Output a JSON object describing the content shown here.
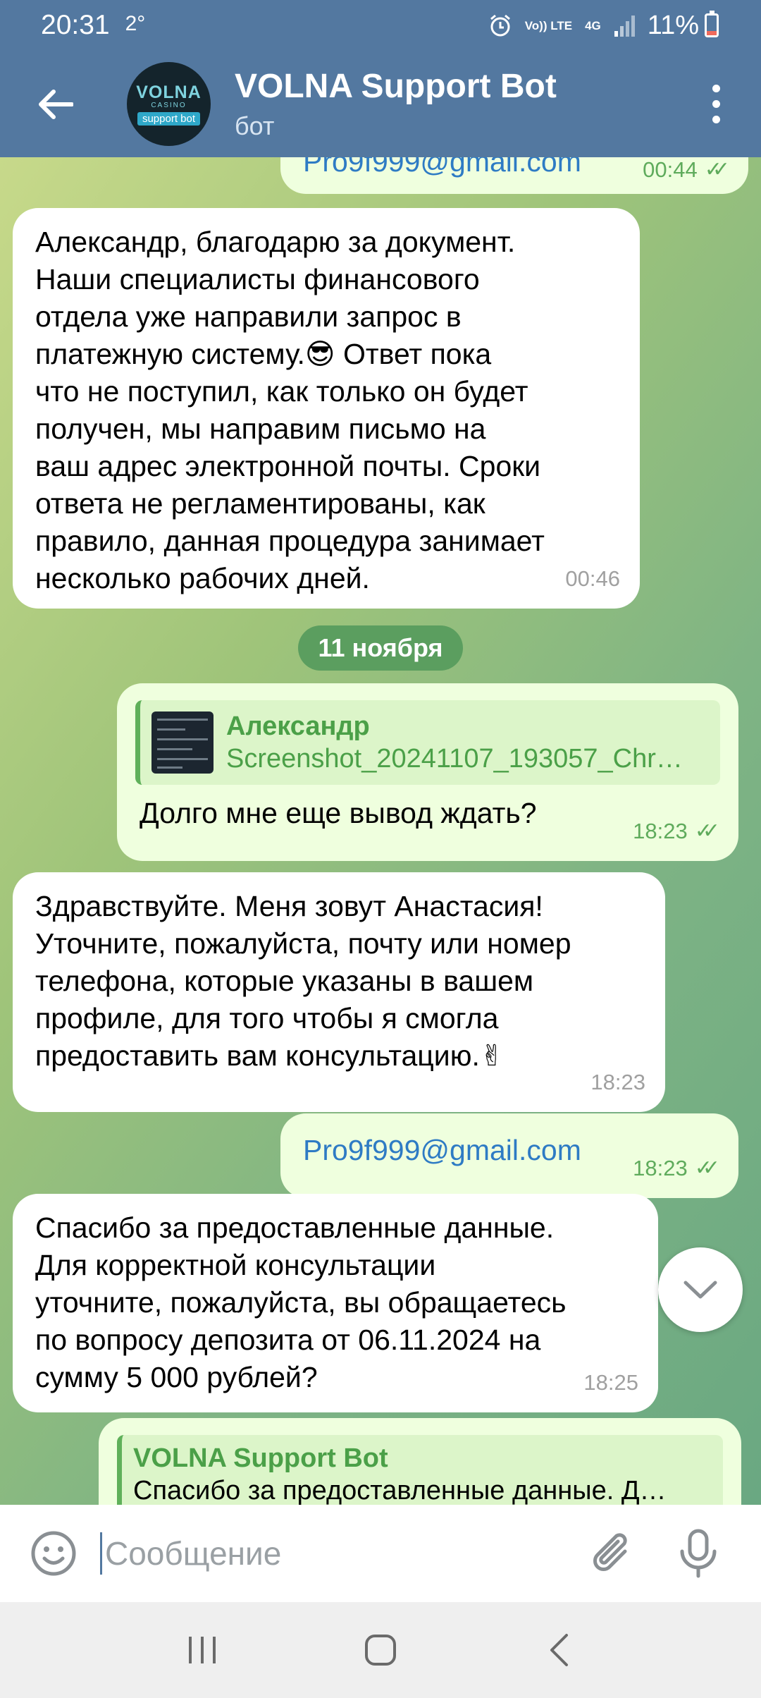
{
  "status_bar": {
    "time": "20:31",
    "temp": "2°",
    "volte": "Vo)) LTE",
    "network": "4G",
    "battery": "11%",
    "battery_level": 0.11
  },
  "header": {
    "title": "VOLNA Support Bot",
    "subtitle": "бот",
    "avatar_logo": "VOLNA",
    "avatar_sub": "CASINO",
    "avatar_badge": "support bot"
  },
  "messages": [
    {
      "id": "m0",
      "direction": "out",
      "text": "Pro9f999@gmail.com",
      "time": "00:44"
    },
    {
      "id": "m1",
      "direction": "in",
      "text": "Александр, благодарю за документ.\nНаши специалисты финансового\nотдела уже направили запрос в\nплатежную систему.😎 Ответ пока\nчто не поступил, как только он будет\nполучен, мы направим письмо на\nваш адрес электронной почты. Сроки\nответа не регламентированы, как\nправило, данная процедура занимает\nнесколько рабочих дней.",
      "time": "00:46"
    },
    {
      "id": "m2",
      "direction": "out",
      "reply_name": "Александр",
      "reply_caption": "Screenshot_20241107_193057_Chro…",
      "text": "Долго мне еще вывод ждать?",
      "time": "18:23"
    },
    {
      "id": "m3",
      "direction": "in",
      "text": "Здравствуйте. Меня зовут  Анастасия!\nУточните, пожалуйста, почту или номер\nтелефона, которые указаны в вашем\nпрофиле, для того чтобы я смогла\nпредоставить вам консультацию.✌",
      "time": "18:23"
    },
    {
      "id": "m4",
      "direction": "out",
      "text": "Pro9f999@gmail.com",
      "time": "18:23"
    },
    {
      "id": "m5",
      "direction": "in",
      "text": "Спасибо за предоставленные данные.\nДля корректной консультации\nуточните, пожалуйста, вы обращаетесь\nпо вопросу депозита от 06.11.2024 на\nсумму 5 000 рублей?",
      "time": "18:25"
    },
    {
      "id": "m6",
      "direction": "out",
      "reply_name": "VOLNA Support Bot",
      "reply_caption": "Спасибо за предоставленные данные. Д…"
    }
  ],
  "date_separator": "11 ноября",
  "input": {
    "placeholder": "Сообщение"
  },
  "colors": {
    "header": "#5378a0",
    "outgoing_bubble": "#efffde",
    "incoming_bubble": "#ffffff",
    "accent_green": "#5fab5c",
    "link": "#2e7bc4"
  },
  "icons": [
    "back-arrow-icon",
    "more-vert-icon",
    "double-check-icon",
    "chevron-down-icon",
    "emoji-icon",
    "attach-icon",
    "mic-icon",
    "recents-icon",
    "home-icon",
    "nav-back-icon",
    "alarm-icon",
    "signal-icon",
    "battery-icon"
  ]
}
